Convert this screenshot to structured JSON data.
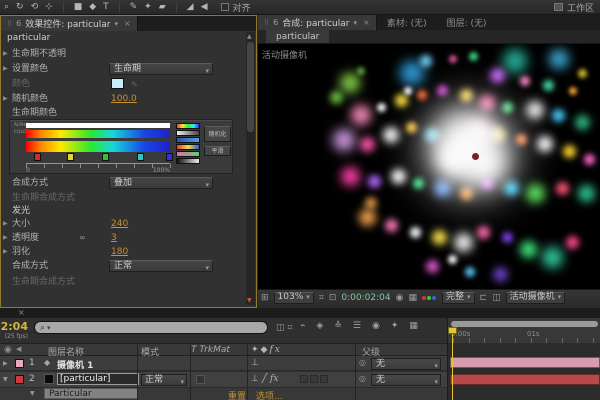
{
  "toolbar": {
    "tools": [
      "⌕",
      "↻",
      "⟲",
      "⊹",
      "■",
      "◆",
      "T",
      "✎",
      "✦",
      "▰",
      "◢",
      "◀"
    ],
    "align_label": "对齐",
    "workspace_label": "工作区"
  },
  "icons": {
    "grip": "⠿",
    "panel_num": "6",
    "dropdown": "▾",
    "close": "×",
    "twirl_open": "▼",
    "twirl_closed": "▶",
    "scroll_up": "▲",
    "scroll_down": "▼",
    "eyedropper": "✎",
    "chain": "∞",
    "magnifier": "⌕",
    "search_dd": "▾",
    "mini1": "◫",
    "mini2": "⌗",
    "expand": "⊞",
    "safe_margins": "⌗",
    "roi": "⊡",
    "snapshot": "◉",
    "grid": "▦",
    "flowchart": "⊏",
    "pixel_aspect": "◫",
    "eye": "◉",
    "speaker": "◀",
    "camera_layer": "◆",
    "solid_thumb": "■",
    "collapse": "⊥",
    "quality": "╱",
    "fx": "fx",
    "pickwhip": "◎"
  },
  "effect_panel": {
    "tab_title": "效果控件: particular",
    "target_layer": "particular",
    "rows": {
      "opacity_over_life": "生命期不透明",
      "set_color_label": "设置颜色",
      "set_color_value": "生命期",
      "color_label": "颜色",
      "color_swatch": "#c9ecfa",
      "random_color_label": "随机颜色",
      "random_color_value": "100.0",
      "color_over_life_label": "生命期颜色"
    },
    "gradient": {
      "alpha_label": "ALPHA",
      "color_label": "COLOR",
      "stops": [
        "#d42a2a",
        "#e0d829",
        "#2fc42f",
        "#2fc4c4",
        "#2a35d4"
      ],
      "stop_positions": [
        24,
        57,
        92,
        127,
        156
      ],
      "ruler_left": "0",
      "ruler_right": "100%",
      "presets": [
        "linear-gradient(90deg,#e33,#ee3,#3e3,#3ee,#33e)",
        "linear-gradient(90deg,#eee,#999,#444)",
        "linear-gradient(90deg,#2a52b0,#5aa0e8)",
        "linear-gradient(90deg,#e33,#e9e433,#3353e0)",
        "linear-gradient(90deg,#e86ab4,#57d46b)",
        "linear-gradient(90deg,#111,#eee)"
      ],
      "randomize_button": "随机化",
      "smooth_button": "平滑"
    },
    "transfer_mode_label": "合成方式",
    "transfer_mode_value": "叠加",
    "transfer_mode_over_life": "生命期合成方式",
    "glow": {
      "section_label": "发光",
      "size_label": "大小",
      "size_value": "240",
      "opacity_label": "透明度",
      "opacity_value": "3",
      "feather_label": "羽化",
      "feather_value": "180",
      "mode_label": "合成方式",
      "mode_value": "正常",
      "mode_over_life": "生命期合成方式"
    }
  },
  "viewer": {
    "tab_title": "合成: particular",
    "footage_tab": "素材: (无)",
    "layer_tab": "图层: (无)",
    "comp_tab": "particular",
    "camera_label": "活动摄像机",
    "zoom_value": "103%",
    "timecode": "0:00:02:04",
    "resolution_value": "完整",
    "camera_view_value": "活动摄像机",
    "emitter_color": "#7a2020",
    "particles": [
      [
        27,
        16,
        20,
        "#86d24a"
      ],
      [
        23,
        22,
        13,
        "#6abf3f"
      ],
      [
        30,
        11,
        8,
        "#5a9e35"
      ],
      [
        45,
        12,
        24,
        "#2f9fe0"
      ],
      [
        49,
        7,
        12,
        "#6fd0ff"
      ],
      [
        44,
        19,
        8,
        "#ffffff"
      ],
      [
        57,
        6,
        8,
        "#e055a0"
      ],
      [
        63,
        5,
        9,
        "#3ddc8a"
      ],
      [
        75,
        7,
        24,
        "#26b29a"
      ],
      [
        88,
        6,
        20,
        "#3aa7d0"
      ],
      [
        95,
        12,
        9,
        "#e0c030"
      ],
      [
        70,
        13,
        15,
        "#cc66ff"
      ],
      [
        78,
        15,
        10,
        "#ff88cc"
      ],
      [
        85,
        17,
        11,
        "#44ddaa"
      ],
      [
        92,
        19,
        8,
        "#ffaa33"
      ],
      [
        30,
        29,
        20,
        "#ff8ec0"
      ],
      [
        36,
        26,
        9,
        "#ffffff"
      ],
      [
        42,
        23,
        13,
        "#ffe43c"
      ],
      [
        48,
        21,
        10,
        "#ff6633"
      ],
      [
        54,
        19,
        11,
        "#cc44cc"
      ],
      [
        61,
        21,
        13,
        "#ffd84e"
      ],
      [
        67,
        24,
        16,
        "#ff77aa"
      ],
      [
        73,
        26,
        11,
        "#58e68c"
      ],
      [
        81,
        27,
        18,
        "#f2f2f2"
      ],
      [
        88,
        29,
        13,
        "#44ccff"
      ],
      [
        95,
        32,
        15,
        "#2fb583"
      ],
      [
        25,
        39,
        22,
        "#d9a0ea"
      ],
      [
        32,
        41,
        15,
        "#ff55aa"
      ],
      [
        39,
        37,
        16,
        "#ffffff"
      ],
      [
        45,
        34,
        11,
        "#ffcc44"
      ],
      [
        51,
        37,
        14,
        "#66ddff"
      ],
      [
        70,
        37,
        15,
        "#ffe766"
      ],
      [
        77,
        39,
        11,
        "#ff8844"
      ],
      [
        84,
        41,
        16,
        "#ffffff"
      ],
      [
        91,
        44,
        13,
        "#ffd832"
      ],
      [
        97,
        47,
        11,
        "#ff66cc"
      ],
      [
        27,
        54,
        19,
        "#ff3fa4"
      ],
      [
        34,
        56,
        13,
        "#b266ff"
      ],
      [
        41,
        54,
        15,
        "#ffffff"
      ],
      [
        47,
        57,
        11,
        "#3fe68f"
      ],
      [
        54,
        59,
        17,
        "#66a3ff"
      ],
      [
        61,
        61,
        13,
        "#ff9933"
      ],
      [
        67,
        57,
        11,
        "#c433ff"
      ],
      [
        74,
        59,
        15,
        "#3fd4ff"
      ],
      [
        81,
        61,
        19,
        "#5ae65a"
      ],
      [
        89,
        59,
        13,
        "#ff5577"
      ],
      [
        96,
        61,
        17,
        "#2fc493"
      ],
      [
        32,
        71,
        17,
        "#f2a44e"
      ],
      [
        33,
        65,
        12,
        "#d98f3f"
      ],
      [
        39,
        74,
        13,
        "#ff77bb"
      ],
      [
        46,
        77,
        11,
        "#ffffff"
      ],
      [
        53,
        79,
        15,
        "#ffe74e"
      ],
      [
        60,
        81,
        19,
        "#f7f7f7"
      ],
      [
        66,
        77,
        13,
        "#ff66aa"
      ],
      [
        73,
        79,
        11,
        "#7a3fe6"
      ],
      [
        79,
        84,
        17,
        "#3fe67f"
      ],
      [
        86,
        87,
        21,
        "#2fcfa0"
      ],
      [
        92,
        81,
        13,
        "#ff4488"
      ],
      [
        51,
        91,
        13,
        "#d955cc"
      ],
      [
        62,
        93,
        10,
        "#55ccff"
      ],
      [
        71,
        94,
        15,
        "#6a3fc4"
      ],
      [
        57,
        88,
        9,
        "#ffffff"
      ],
      [
        62,
        43,
        85,
        "#ffffff"
      ],
      [
        60,
        40,
        50,
        "#ffffff"
      ],
      [
        66,
        49,
        42,
        "#ffffff"
      ],
      [
        57,
        47,
        30,
        "#ffffff"
      ],
      [
        65,
        36,
        26,
        "#ffd8ff"
      ]
    ]
  },
  "timeline": {
    "timecode": "0:00:02:04",
    "fps_label": "(25 fps)",
    "comp_icons": [
      "⌁",
      "◈",
      "≙",
      "☰",
      "◉",
      "✦",
      "▦"
    ],
    "columns": {
      "layer_name": "图层名称",
      "mode": "模式",
      "trkmat": "T TrkMat",
      "parent": "父级"
    },
    "ruler_labels": [
      "0:00s",
      "01s"
    ],
    "ruler_label_x": [
      3,
      79
    ],
    "layers": [
      {
        "index": "1",
        "name": "摄像机 1",
        "swatch": "#e8a8bc",
        "parent_value": "无",
        "bar_color": "#d79cb0"
      },
      {
        "index": "2",
        "name": "[particular]",
        "swatch": "#cc3c3c",
        "mode_value": "正常",
        "parent_value": "无",
        "bar_color": "#b64a4a"
      }
    ],
    "effect_row": {
      "name": "Particular",
      "reset_label": "重置",
      "options_label": "选项..."
    }
  }
}
